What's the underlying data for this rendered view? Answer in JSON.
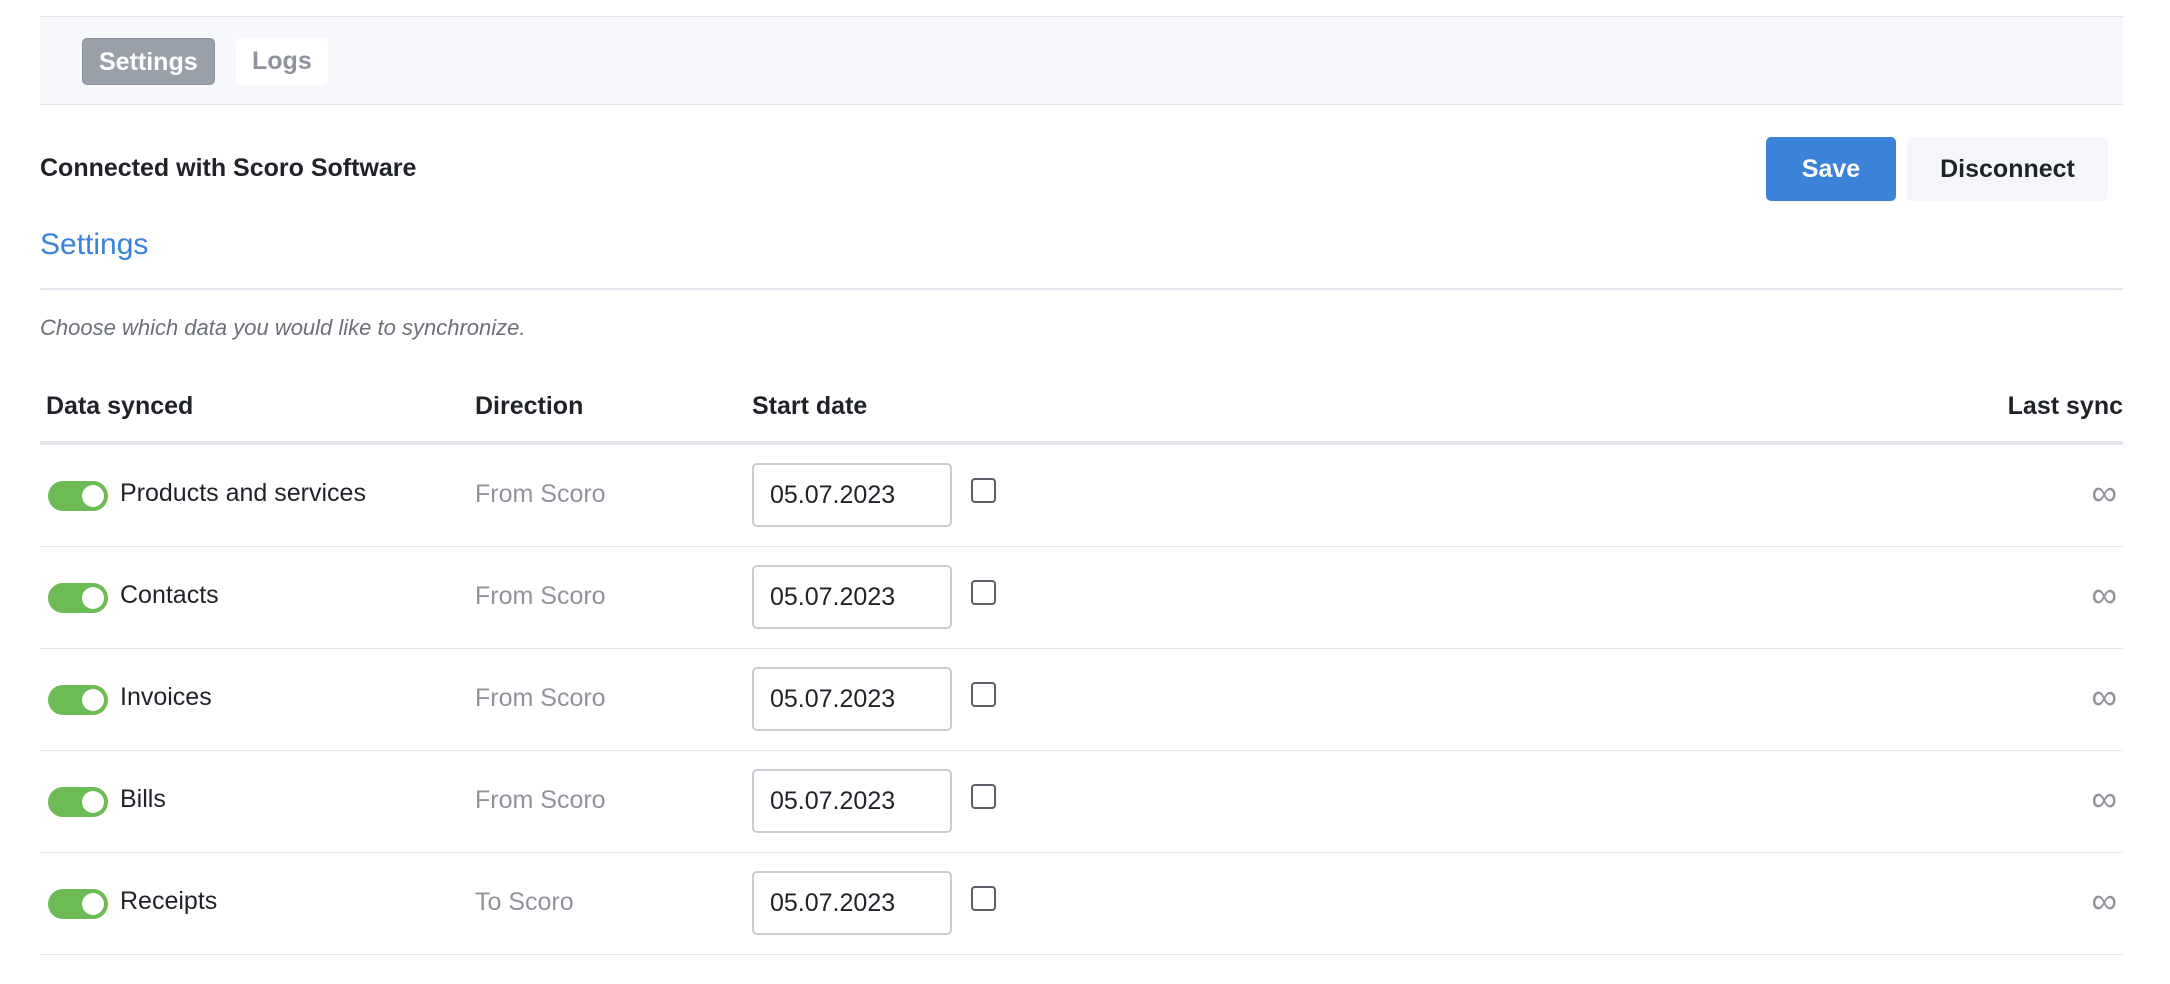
{
  "tabs": [
    {
      "label": "Settings",
      "active": true
    },
    {
      "label": "Logs",
      "active": false
    }
  ],
  "header": {
    "connected_text": "Connected with Scoro Software",
    "save_label": "Save",
    "disconnect_label": "Disconnect"
  },
  "settings": {
    "title": "Settings",
    "hint": "Choose which data you would like to synchronize."
  },
  "table": {
    "columns": [
      "Data synced",
      "Direction",
      "Start date",
      "Last sync"
    ],
    "rows": [
      {
        "label": "Products and services",
        "direction": "From Scoro",
        "start_date": "05.07.2023",
        "enabled": true,
        "checked": false,
        "last_sync_icon": "infinity-icon"
      },
      {
        "label": "Contacts",
        "direction": "From Scoro",
        "start_date": "05.07.2023",
        "enabled": true,
        "checked": false,
        "last_sync_icon": "infinity-icon"
      },
      {
        "label": "Invoices",
        "direction": "From Scoro",
        "start_date": "05.07.2023",
        "enabled": true,
        "checked": false,
        "last_sync_icon": "infinity-icon"
      },
      {
        "label": "Bills",
        "direction": "From Scoro",
        "start_date": "05.07.2023",
        "enabled": true,
        "checked": false,
        "last_sync_icon": "infinity-icon"
      },
      {
        "label": "Receipts",
        "direction": "To Scoro",
        "start_date": "05.07.2023",
        "enabled": true,
        "checked": false,
        "last_sync_icon": "infinity-icon"
      }
    ]
  },
  "colors": {
    "accent": "#3b82d8",
    "toggle_on": "#6cbb54",
    "muted_text": "#8f949c"
  }
}
